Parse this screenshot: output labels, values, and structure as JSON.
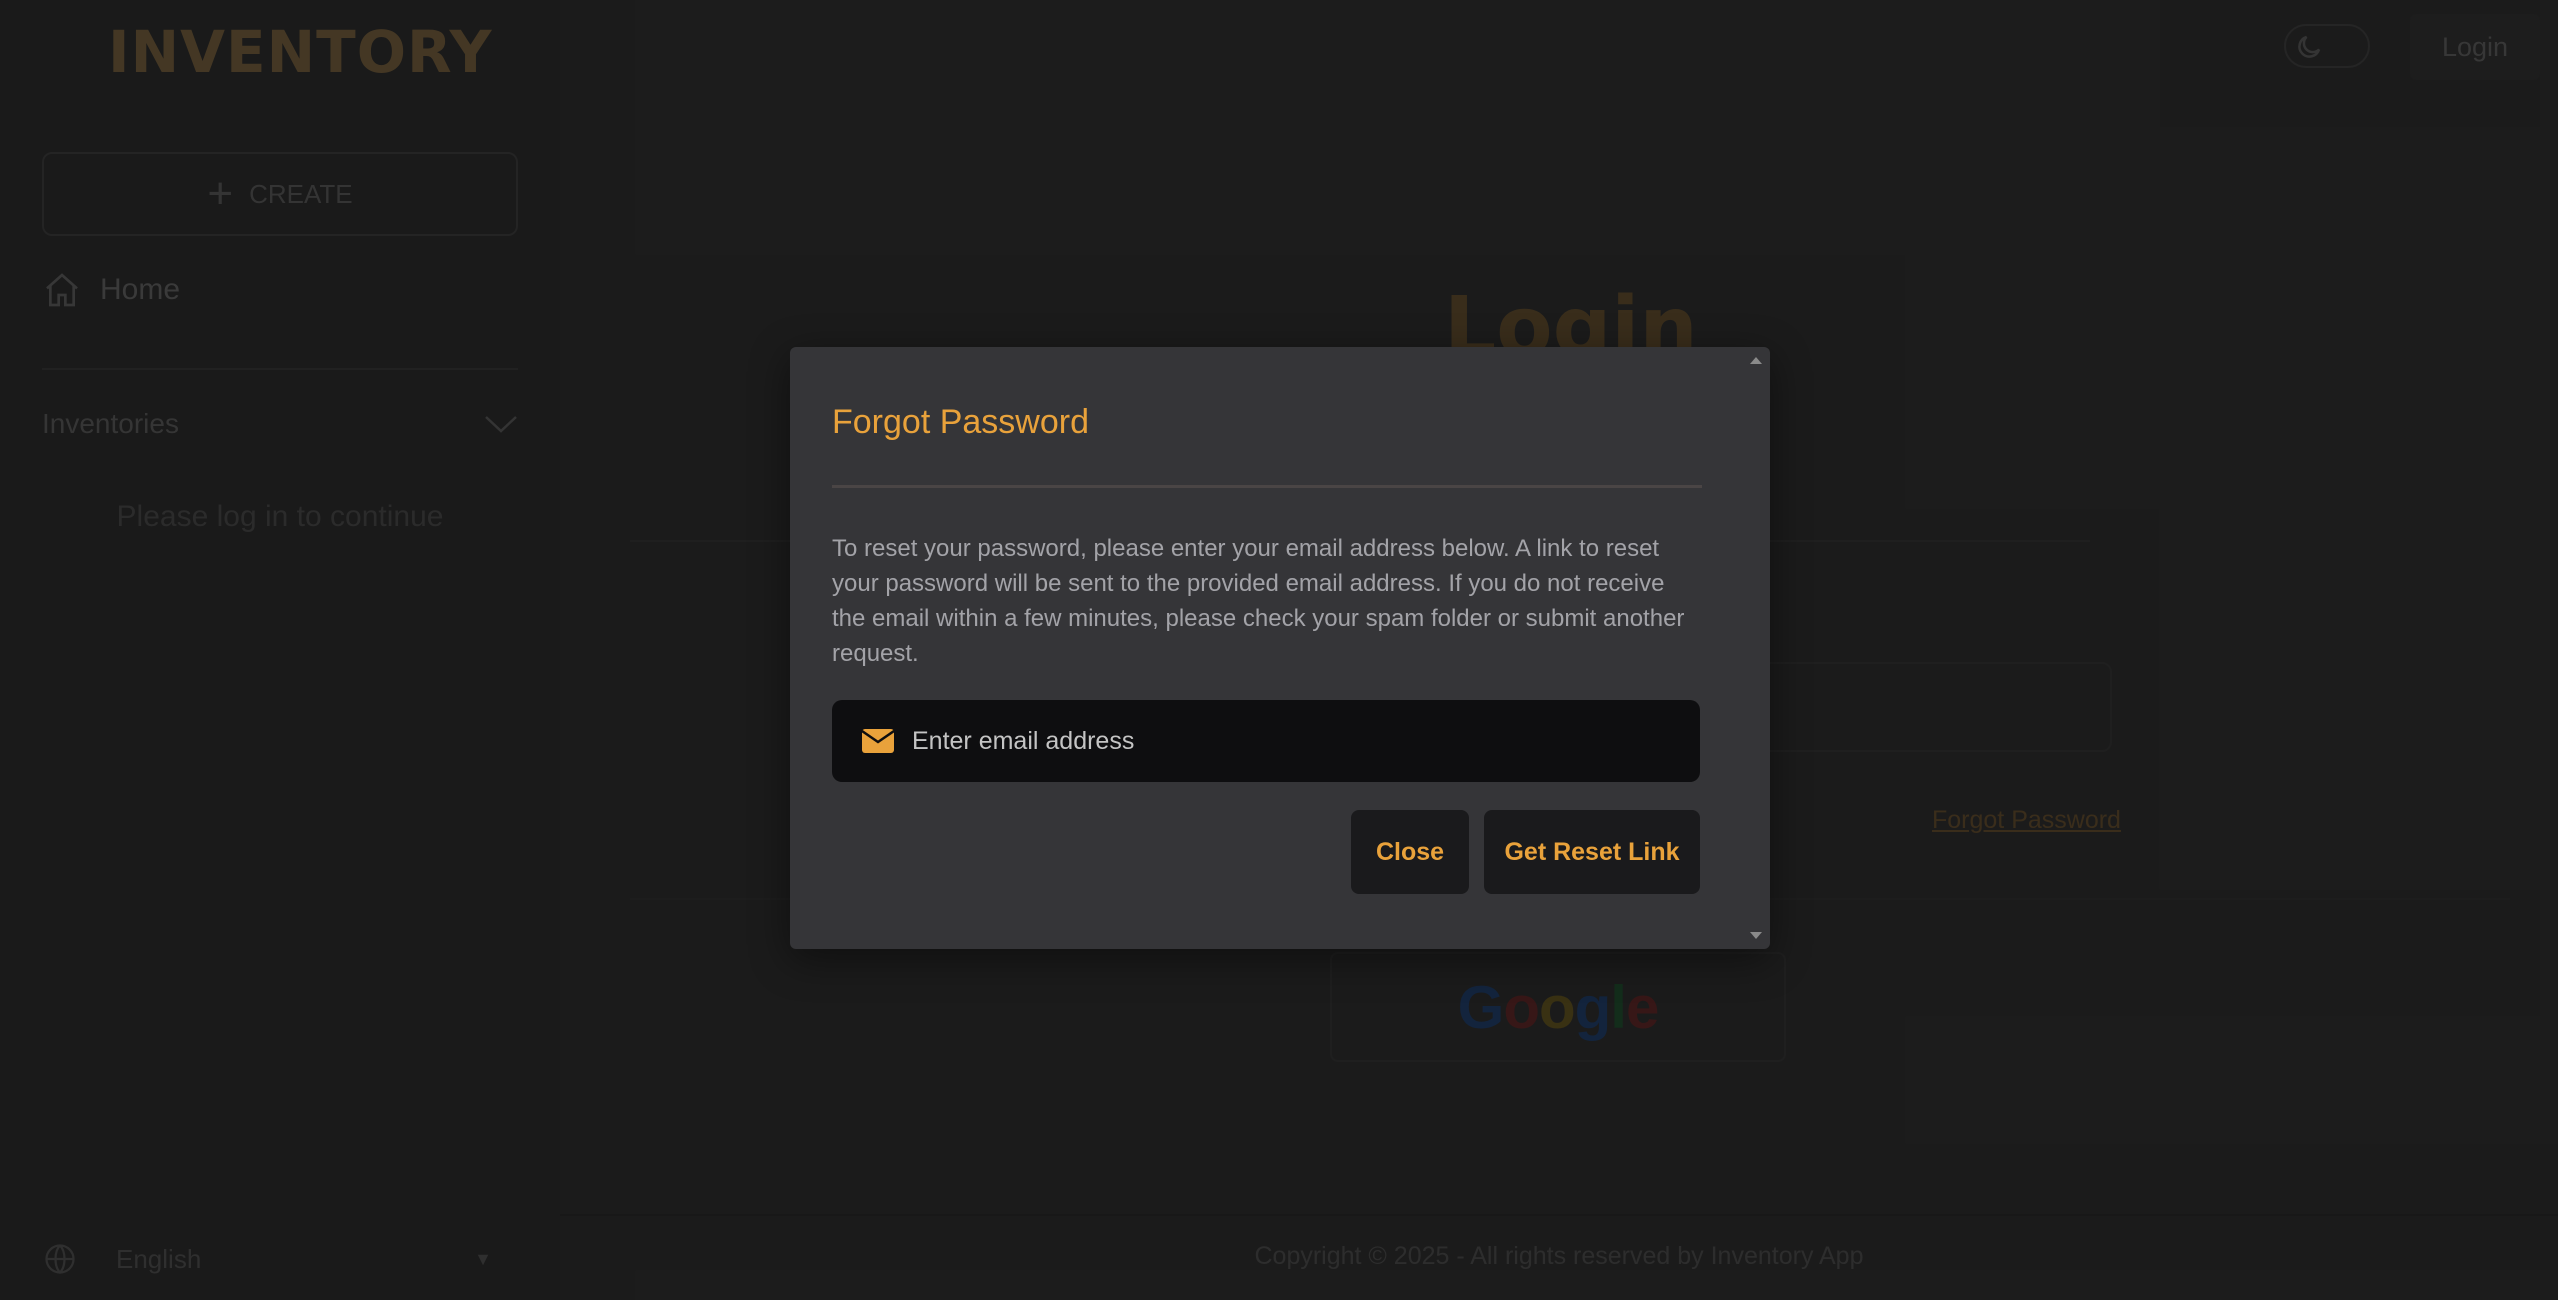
{
  "sidebar": {
    "logo": "INVENTORY",
    "create_label": "CREATE",
    "home_label": "Home",
    "inventories_label": "Inventories",
    "login_hint": "Please log in to continue",
    "language": "English"
  },
  "header": {
    "login_label": "Login"
  },
  "main": {
    "login_title": "Login",
    "forgot_password_link": "Forgot Password",
    "google_label": [
      "G",
      "o",
      "o",
      "g",
      "l",
      "e"
    ],
    "footer": "Copyright © 2025 - All rights reserved by Inventory App"
  },
  "modal": {
    "title": "Forgot Password",
    "description": "To reset your password, please enter your email address below. A link to reset your password will be sent to the provided email address. If you do not receive the email within a few minutes, please check your spam folder or submit another request.",
    "email_placeholder": "Enter email address",
    "email_value": "",
    "close_label": "Close",
    "reset_label": "Get Reset Link"
  },
  "colors": {
    "accent": "#e9a23b",
    "modal_bg": "#353538",
    "page_bg": "#2d2d2d"
  },
  "icons": {
    "create": "plus-icon",
    "home": "home-icon",
    "inventories": "chevron-down-icon",
    "language": "globe-icon",
    "theme": "moon-icon",
    "email": "envelope-icon"
  }
}
